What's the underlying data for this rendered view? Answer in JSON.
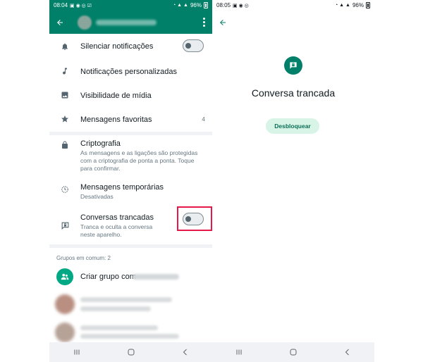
{
  "left": {
    "status": {
      "time": "08:04",
      "battery": "96%"
    },
    "settings": [
      {
        "id": "mute",
        "title": "Silenciar notificações",
        "icon": "bell-icon"
      },
      {
        "id": "custom",
        "title": "Notificações personalizadas",
        "icon": "music-note-icon"
      },
      {
        "id": "media",
        "title": "Visibilidade de mídia",
        "icon": "image-icon"
      },
      {
        "id": "starred",
        "title": "Mensagens favoritas",
        "icon": "star-icon",
        "count": "4"
      },
      {
        "id": "encryption",
        "title": "Criptografia",
        "subtitle": "As mensagens e as ligações são protegidas com a criptografia de ponta a ponta. Toque para confirmar.",
        "icon": "lock-icon"
      },
      {
        "id": "disappearing",
        "title": "Mensagens temporárias",
        "subtitle": "Desativadas",
        "icon": "timer-icon"
      },
      {
        "id": "locked",
        "title": "Conversas trancadas",
        "subtitle": "Tranca e oculta a conversa neste aparelho.",
        "icon": "chat-lock-icon"
      }
    ],
    "toggles": {
      "mute_on": false,
      "locked_on": false
    },
    "groups": {
      "section_label": "Grupos em comum: 2",
      "create_label": "Criar grupo com"
    },
    "colors": {
      "primary": "#008069",
      "highlight": "#e5184a"
    }
  },
  "right": {
    "status": {
      "time": "08:05",
      "battery": "96%"
    },
    "locked_title": "Conversa trancada",
    "unlock_label": "Desbloquear",
    "colors": {
      "primary": "#008069",
      "button_bg": "#d8f4e7"
    }
  }
}
